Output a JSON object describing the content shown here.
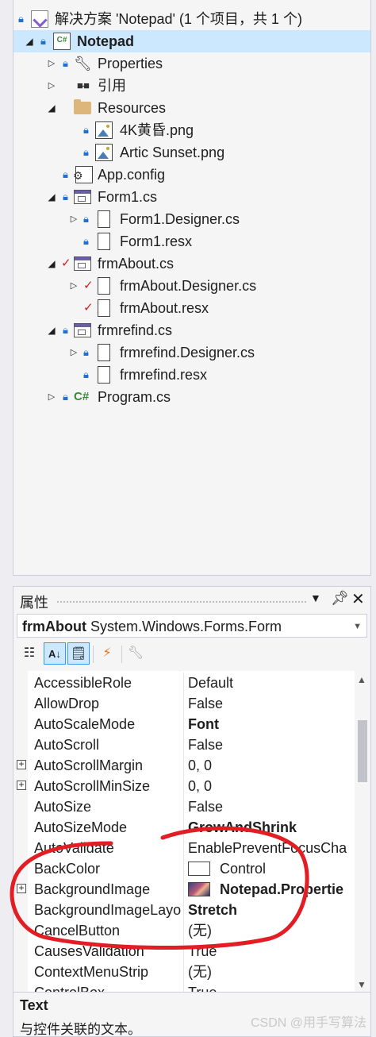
{
  "solution_explorer": {
    "items": [
      {
        "label": "解决方案 'Notepad' (1 个项目，共 1 个)",
        "icon": "solution-icon",
        "status": "lock"
      },
      {
        "label": "Notepad",
        "icon": "csharp-project-icon",
        "status": "lock",
        "selected": true
      },
      {
        "label": "Properties",
        "icon": "wrench-icon",
        "status": "lock"
      },
      {
        "label": "引用",
        "icon": "references-icon"
      },
      {
        "label": "Resources",
        "icon": "folder-icon"
      },
      {
        "label": "4K黄昏.png",
        "icon": "image-file-icon",
        "status": "lock"
      },
      {
        "label": "Artic Sunset.png",
        "icon": "image-file-icon",
        "status": "lock"
      },
      {
        "label": "App.config",
        "icon": "config-file-icon",
        "status": "lock"
      },
      {
        "label": "Form1.cs",
        "icon": "form-icon",
        "status": "lock"
      },
      {
        "label": "Form1.Designer.cs",
        "icon": "file-icon",
        "status": "lock"
      },
      {
        "label": "Form1.resx",
        "icon": "file-icon",
        "status": "lock"
      },
      {
        "label": "frmAbout.cs",
        "icon": "form-icon",
        "status": "checked"
      },
      {
        "label": "frmAbout.Designer.cs",
        "icon": "file-icon",
        "status": "checked"
      },
      {
        "label": "frmAbout.resx",
        "icon": "file-icon",
        "status": "checked"
      },
      {
        "label": "frmrefind.cs",
        "icon": "form-icon",
        "status": "lock"
      },
      {
        "label": "frmrefind.Designer.cs",
        "icon": "file-icon",
        "status": "lock"
      },
      {
        "label": "frmrefind.resx",
        "icon": "file-icon",
        "status": "lock"
      },
      {
        "label": "Program.cs",
        "icon": "csharp-file-icon",
        "status": "lock"
      }
    ]
  },
  "properties": {
    "title": "属性",
    "object_name": "frmAbout",
    "object_type": "System.Windows.Forms.Form",
    "toolbar": [
      "categorized-icon",
      "alphabetical-icon",
      "properties-icon",
      "events-icon",
      "property-pages-icon"
    ],
    "rows": [
      {
        "name": "AccessibleRole",
        "value": "Default",
        "bold": false,
        "expandable": false
      },
      {
        "name": "AllowDrop",
        "value": "False",
        "bold": false,
        "expandable": false
      },
      {
        "name": "AutoScaleMode",
        "value": "Font",
        "bold": true,
        "expandable": false
      },
      {
        "name": "AutoScroll",
        "value": "False",
        "bold": false,
        "expandable": false
      },
      {
        "name": "AutoScrollMargin",
        "value": "0, 0",
        "bold": false,
        "expandable": true
      },
      {
        "name": "AutoScrollMinSize",
        "value": "0, 0",
        "bold": false,
        "expandable": true
      },
      {
        "name": "AutoSize",
        "value": "False",
        "bold": false,
        "expandable": false
      },
      {
        "name": "AutoSizeMode",
        "value": "GrowAndShrink",
        "bold": true,
        "expandable": false
      },
      {
        "name": "AutoValidate",
        "value": "EnablePreventFocusCha",
        "bold": false,
        "expandable": false
      },
      {
        "name": "BackColor",
        "value": "Control",
        "bold": false,
        "expandable": false,
        "swatch": "white"
      },
      {
        "name": "BackgroundImage",
        "value": "Notepad.Propertie",
        "bold": true,
        "expandable": true,
        "swatch": "image"
      },
      {
        "name": "BackgroundImageLayo",
        "value": "Stretch",
        "bold": true,
        "expandable": false
      },
      {
        "name": "CancelButton",
        "value": "(无)",
        "bold": false,
        "expandable": false
      },
      {
        "name": "CausesValidation",
        "value": "True",
        "bold": false,
        "expandable": false
      },
      {
        "name": "ContextMenuStrip",
        "value": "(无)",
        "bold": false,
        "expandable": false
      },
      {
        "name": "ControlBox",
        "value": "True",
        "bold": false,
        "expandable": false
      }
    ],
    "description": {
      "title": "Text",
      "text": "与控件关联的文本。"
    }
  },
  "watermark": "CSDN @用手写算法",
  "colors": {
    "annotation": "#e21e24",
    "selection": "#cce8ff",
    "lock": "#1f6fd0",
    "checkmark": "#c81f1f"
  }
}
